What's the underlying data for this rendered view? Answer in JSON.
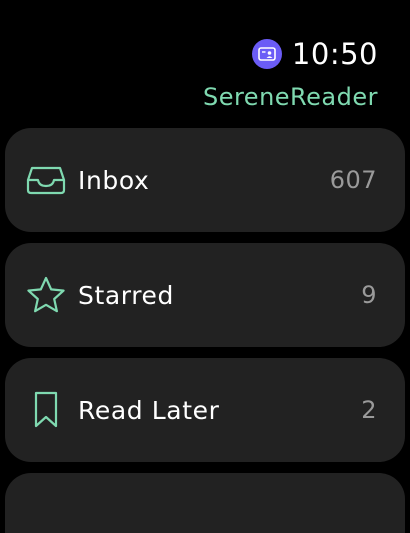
{
  "status": {
    "time": "10:50",
    "indicator_icon": "contact-card-icon",
    "indicator_color": "#6b5cf6"
  },
  "app": {
    "title": "SereneReader",
    "accent_color": "#7fd9b0"
  },
  "list": {
    "items": [
      {
        "label": "Inbox",
        "count": "607",
        "icon": "inbox-tray-icon"
      },
      {
        "label": "Starred",
        "count": "9",
        "icon": "star-icon"
      },
      {
        "label": "Read Later",
        "count": "2",
        "icon": "bookmark-icon"
      }
    ]
  }
}
